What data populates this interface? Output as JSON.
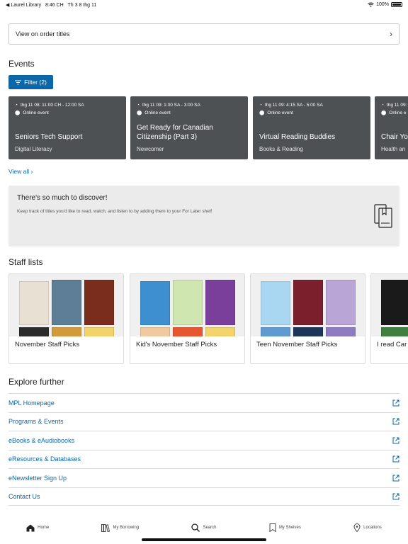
{
  "status_bar": {
    "back_app": "◀ Laurel Library",
    "time": "8:46 CH",
    "date": "Th 3 8 thg 11",
    "battery": "100%"
  },
  "order_titles": {
    "label": "View on order titles"
  },
  "events": {
    "title": "Events",
    "filter_label": "Filter (2)",
    "view_all": "View all ›",
    "cards": [
      {
        "time": "thg 11 08: 11:00 CH - 12:00 SA",
        "location": "Online event",
        "title": "Seniors Tech Support",
        "category": "Digital Literacy"
      },
      {
        "time": "thg 11 09: 1:00 SA - 3:00 SA",
        "location": "Online event",
        "title": "Get Ready for Canadian Citizenship (Part 3)",
        "category": "Newcomer"
      },
      {
        "time": "thg 11 09: 4:15 SA - 5:00 SA",
        "location": "Online event",
        "title": "Virtual Reading Buddies",
        "category": "Books & Reading"
      },
      {
        "time": "thg 11 09:",
        "location": "Online e",
        "title": "Chair Yo",
        "category": "Health an"
      }
    ]
  },
  "discover": {
    "title": "There's so much to discover!",
    "subtitle": "Keep track of titles you'd like to read, watch, and listen to by adding them to your For Later shelf"
  },
  "staff_lists": {
    "title": "Staff lists",
    "cards": [
      {
        "name": "November Staff Picks"
      },
      {
        "name": "Kid's November Staff Picks"
      },
      {
        "name": "Teen November Staff Picks"
      },
      {
        "name": "I read Car"
      }
    ]
  },
  "explore": {
    "title": "Explore further",
    "links": [
      "MPL Homepage",
      "Programs & Events",
      "eBooks & eAudiobooks",
      "eResources & Databases",
      "eNewsletter Sign Up",
      "Contact Us"
    ]
  },
  "tabbar": {
    "home": "Home",
    "borrowing": "My Borrowing",
    "search": "Search",
    "shelves": "My Shelves",
    "locations": "Locations"
  },
  "colors": {
    "accent": "#0b67a8",
    "card_bg": "#4d5154"
  }
}
